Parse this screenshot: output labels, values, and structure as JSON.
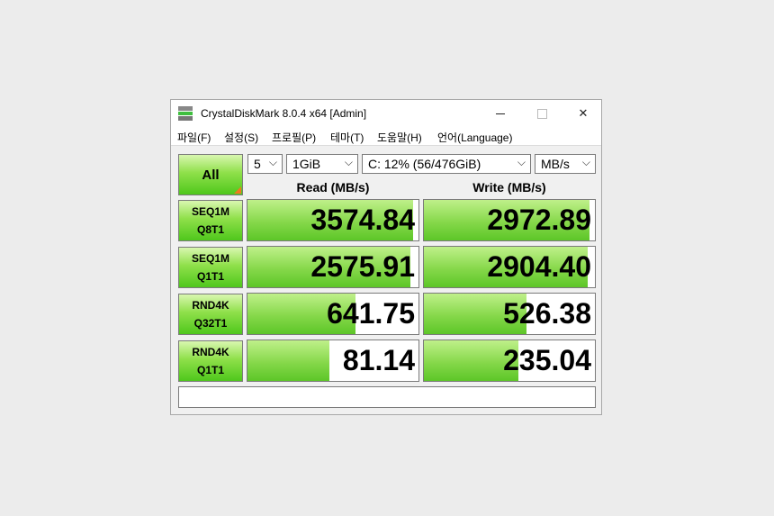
{
  "window": {
    "title": "CrystalDiskMark 8.0.4 x64 [Admin]",
    "close_glyph": "✕"
  },
  "menu": [
    "파일(F)",
    "설정(S)",
    "프로필(P)",
    "테마(T)",
    "도움말(H)",
    "언어(Language)"
  ],
  "controls": {
    "all_label": "All",
    "count": "5",
    "size": "1GiB",
    "drive": "C: 12% (56/476GiB)",
    "unit": "MB/s",
    "arrow": "⌵"
  },
  "headers": {
    "read": "Read (MB/s)",
    "write": "Write (MB/s)"
  },
  "rows": [
    {
      "line1": "SEQ1M",
      "line2": "Q8T1",
      "read": "3574.84",
      "write": "2972.89",
      "read_fill": 0.97,
      "write_fill": 0.97
    },
    {
      "line1": "SEQ1M",
      "line2": "Q1T1",
      "read": "2575.91",
      "write": "2904.40",
      "read_fill": 0.95,
      "write_fill": 0.96
    },
    {
      "line1": "RND4K",
      "line2": "Q32T1",
      "read": "641.75",
      "write": "526.38",
      "read_fill": 0.63,
      "write_fill": 0.6
    },
    {
      "line1": "RND4K",
      "line2": "Q1T1",
      "read": "81.14",
      "write": "235.04",
      "read_fill": 0.48,
      "write_fill": 0.55
    }
  ],
  "comment": ""
}
